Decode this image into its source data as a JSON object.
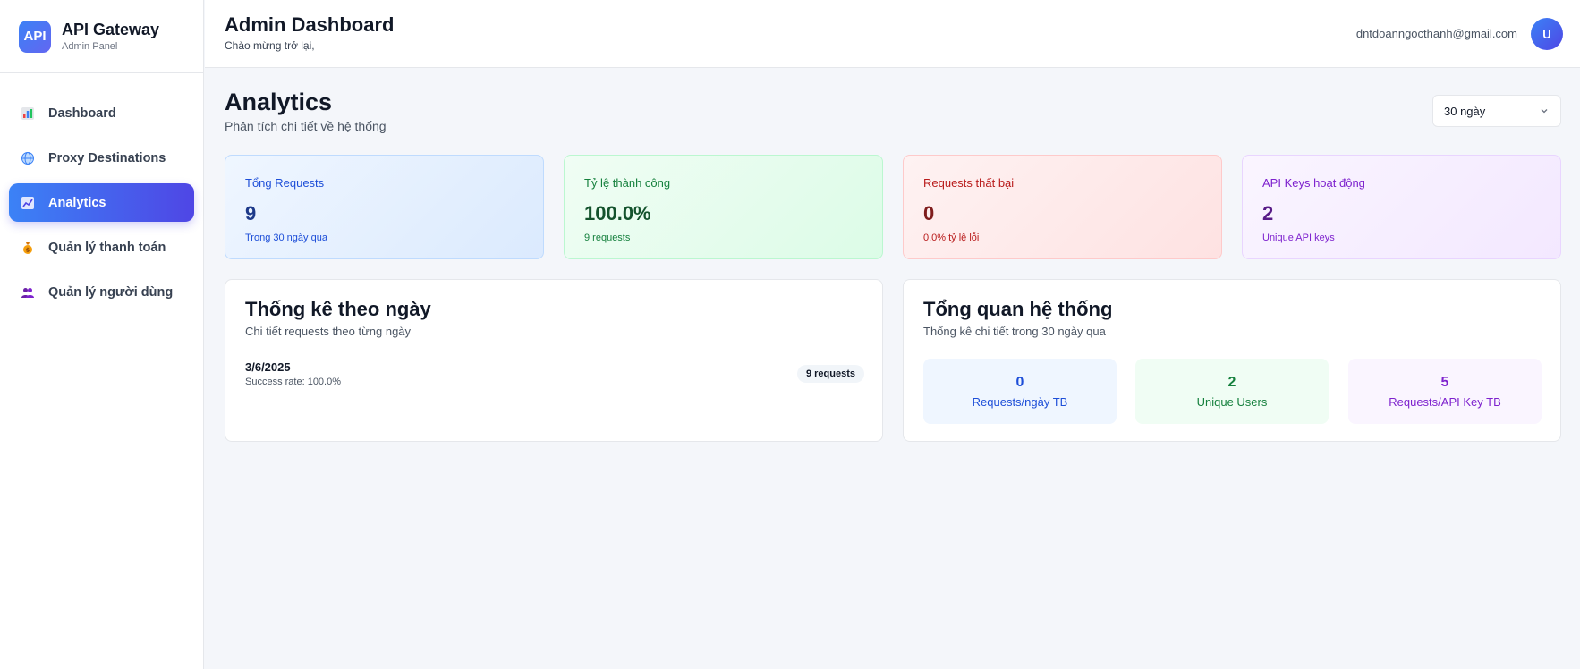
{
  "brand": {
    "logo_text": "API",
    "title": "API Gateway",
    "subtitle": "Admin Panel"
  },
  "sidebar": {
    "items": [
      {
        "label": "Dashboard",
        "icon": "bar-chart-icon",
        "active": false
      },
      {
        "label": "Proxy Destinations",
        "icon": "globe-icon",
        "active": false
      },
      {
        "label": "Analytics",
        "icon": "trend-chart-icon",
        "active": true
      },
      {
        "label": "Quản lý thanh toán",
        "icon": "money-bag-icon",
        "active": false
      },
      {
        "label": "Quản lý người dùng",
        "icon": "users-icon",
        "active": false
      }
    ]
  },
  "header": {
    "title": "Admin Dashboard",
    "subtitle": "Chào mừng trở lại,",
    "email": "dntdoanngocthanh@gmail.com",
    "avatar_initial": "U"
  },
  "page": {
    "title": "Analytics",
    "subtitle": "Phân tích chi tiết về hệ thống",
    "range_select": {
      "value": "30 ngày"
    }
  },
  "stats": [
    {
      "label": "Tổng Requests",
      "value": "9",
      "note": "Trong 30 ngày qua",
      "color": "#1d4ed8"
    },
    {
      "label": "Tỷ lệ thành công",
      "value": "100.0%",
      "note": "9 requests",
      "color": "#15803d"
    },
    {
      "label": "Requests thất bại",
      "value": "0",
      "note": "0.0% tỷ lệ lỗi",
      "color": "#b91c1c"
    },
    {
      "label": "API Keys hoạt động",
      "value": "2",
      "note": "Unique API keys",
      "color": "#7e22ce"
    }
  ],
  "daily": {
    "title": "Thống kê theo ngày",
    "subtitle": "Chi tiết requests theo từng ngày",
    "rows": [
      {
        "date": "3/6/2025",
        "rate": "Success rate: 100.0%",
        "badge": "9 requests"
      }
    ]
  },
  "overview": {
    "title": "Tổng quan hệ thống",
    "subtitle": "Thống kê chi tiết trong 30 ngày qua",
    "metrics": [
      {
        "value": "0",
        "label": "Requests/ngày TB"
      },
      {
        "value": "2",
        "label": "Unique Users"
      },
      {
        "value": "5",
        "label": "Requests/API Key TB"
      }
    ]
  }
}
